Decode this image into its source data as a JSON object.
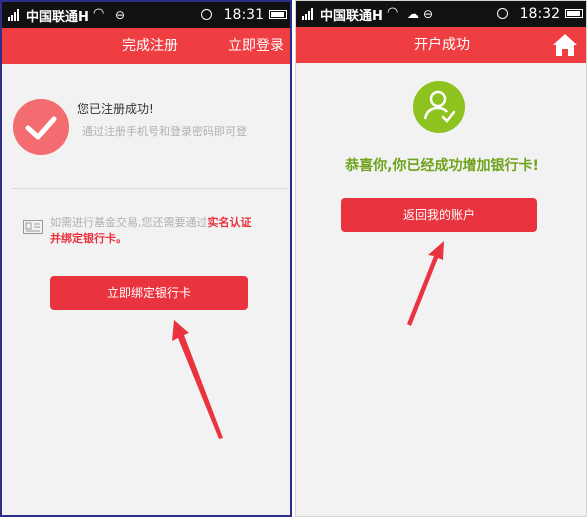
{
  "left": {
    "status": {
      "carrier": "中国联通H",
      "time": "18:31"
    },
    "header": {
      "title": "完成注册",
      "login_link": "立即登录"
    },
    "success": {
      "heading": "您已注册成功!",
      "sub": "通过注册手机号和登录密码即可登"
    },
    "notice": {
      "text1": "如需进行基金交易,您还需要通过",
      "link1": "实名认证",
      "link2": "并绑定银行卡。"
    },
    "bind_button": "立即绑定银行卡"
  },
  "right": {
    "status": {
      "carrier": "中国联通H",
      "time": "18:32"
    },
    "header": {
      "title": "开户成功"
    },
    "message": "恭喜你,你已经成功增加银行卡!",
    "return_button": "返回我的账户"
  },
  "colors": {
    "brand_red": "#ef3e42",
    "success_green": "#8dc21f",
    "message_green": "#6ea21a"
  },
  "icons": [
    "signal-icon",
    "wifi-icon",
    "chat-icon",
    "alarm-icon",
    "battery-icon",
    "checkmark-icon",
    "id-card-icon",
    "user-check-icon",
    "home-icon",
    "cloud-icon",
    "arrow-annotation-icon"
  ]
}
